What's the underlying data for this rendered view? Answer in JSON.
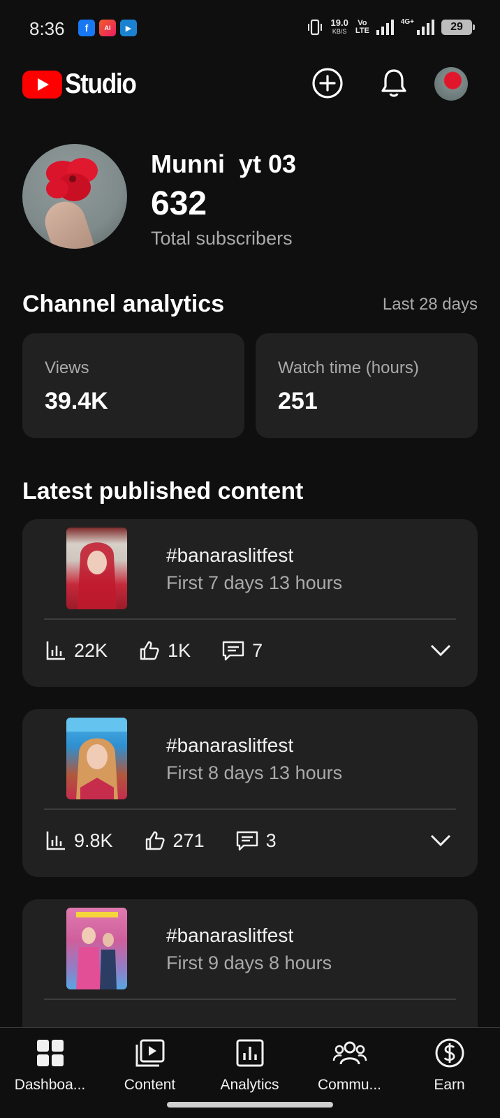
{
  "status_bar": {
    "time": "8:36",
    "apps": [
      {
        "label": "f",
        "color": "#1877f2",
        "icon": "facebook-icon"
      },
      {
        "label": "AI",
        "color": "#f25c2b",
        "icon": "ad-app-icon"
      },
      {
        "label": "▶",
        "color": "#1b82d1",
        "icon": "media-app-icon"
      }
    ],
    "net_speed": "19.0",
    "net_unit": "KB/S",
    "volte_top": "Vo",
    "volte_bottom": "LTE",
    "network": "4G+",
    "battery": "29"
  },
  "header": {
    "logo_text": "Studio",
    "create_icon": "plus-circle-icon",
    "notifications_icon": "bell-icon",
    "avatar_icon": "avatar"
  },
  "profile": {
    "channel_name": "Munni  yt 03",
    "subscriber_count": "632",
    "subscriber_label": "Total subscribers"
  },
  "channel_analytics": {
    "title": "Channel analytics",
    "range": "Last 28 days",
    "cards": [
      {
        "label": "Views",
        "value": "39.4K"
      },
      {
        "label": "Watch time (hours)",
        "value": "251"
      }
    ]
  },
  "latest_content": {
    "title": "Latest published content",
    "items": [
      {
        "title": "#banaraslitfest",
        "subtitle": "First 7 days 13 hours",
        "views": "22K",
        "likes": "1K",
        "comments": "7"
      },
      {
        "title": "#banaraslitfest",
        "subtitle": "First 8 days 13 hours",
        "views": "9.8K",
        "likes": "271",
        "comments": "3"
      },
      {
        "title": "#banaraslitfest",
        "subtitle": "First 9 days 8 hours",
        "views": "",
        "likes": "",
        "comments": ""
      }
    ]
  },
  "bottom_nav": [
    {
      "label": "Dashboa...",
      "icon": "dashboard-icon"
    },
    {
      "label": "Content",
      "icon": "content-icon"
    },
    {
      "label": "Analytics",
      "icon": "analytics-icon"
    },
    {
      "label": "Commu...",
      "icon": "community-icon"
    },
    {
      "label": "Earn",
      "icon": "earn-icon"
    }
  ],
  "colors": {
    "background": "#0f0f0f",
    "card": "#212121",
    "brand_red": "#ff0000",
    "secondary_text": "#aaaaaa"
  }
}
